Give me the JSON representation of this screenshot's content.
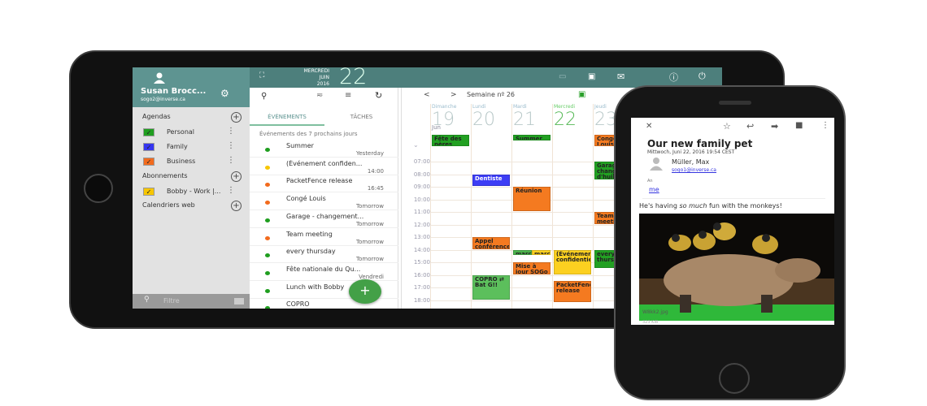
{
  "tablet": {
    "user": {
      "name": "Susan Brocc...",
      "email": "sogo2@inverse.ca"
    },
    "date": {
      "weekday": "MERCREDI",
      "month": "JUIN",
      "year": "2016",
      "day": "22"
    },
    "sidebar": {
      "agendas_label": "Agendas",
      "agendas": [
        {
          "label": "Personal",
          "color": "#1f9e1f"
        },
        {
          "label": "Family",
          "color": "#3535f0"
        },
        {
          "label": "Business",
          "color": "#f26b1d"
        }
      ],
      "subscriptions_label": "Abonnements",
      "subscriptions": [
        {
          "label": "Bobby - Work |...",
          "color": "#f7c600"
        }
      ],
      "web_label": "Calendriers web",
      "filter_placeholder": "Filtre"
    },
    "list": {
      "tabs": [
        {
          "label": "ÉVÉNEMENTS",
          "active": true
        },
        {
          "label": "TÂCHES",
          "active": false
        }
      ],
      "subtitle": "Événements des 7 prochains jours",
      "items": [
        {
          "title": "Summer",
          "when": "Yesterday",
          "color": "#1f9e1f"
        },
        {
          "title": "(Événement confiden...",
          "when": "14:00",
          "color": "#f7c600"
        },
        {
          "title": "PacketFence release",
          "when": "16:45",
          "color": "#f26b1d"
        },
        {
          "title": "Congé Louis",
          "when": "Tomorrow",
          "color": "#f26b1d"
        },
        {
          "title": "Garage - changement...",
          "when": "Tomorrow",
          "color": "#1f9e1f"
        },
        {
          "title": "Team meeting",
          "when": "Tomorrow",
          "color": "#f26b1d"
        },
        {
          "title": "every thursday",
          "when": "Tomorrow",
          "color": "#1f9e1f"
        },
        {
          "title": "Fête nationale du Qu...",
          "when": "Vendredi",
          "color": "#1f9e1f"
        },
        {
          "title": "Lunch with Bobby",
          "when": "",
          "color": "#1f9e1f"
        },
        {
          "title": "COPRO",
          "when": "",
          "color": "#1f9e1f"
        }
      ],
      "fab": "+"
    },
    "calendar": {
      "prev": "<",
      "next": ">",
      "week_label": "Semaine nº 26",
      "month_label": "Jun",
      "days": [
        {
          "name": "Dimanche",
          "num": "19"
        },
        {
          "name": "Lundi",
          "num": "20"
        },
        {
          "name": "Mardi",
          "num": "21"
        },
        {
          "name": "Mercredi",
          "num": "22",
          "today": true
        },
        {
          "name": "Jeudi",
          "num": "23"
        }
      ],
      "hours": [
        "07:00",
        "08:00",
        "09:00",
        "10:00",
        "11:00",
        "12:00",
        "13:00",
        "14:00",
        "15:00",
        "16:00",
        "17:00",
        "18:00"
      ],
      "all_day": [
        {
          "day": 0,
          "title": "Fête des pères",
          "color": "#22a022"
        },
        {
          "day": 2,
          "title": "Summer",
          "color": "#22a022"
        },
        {
          "day": 4,
          "title": "Congé Louis",
          "color": "#f47a20"
        }
      ],
      "events": [
        {
          "day": 1,
          "start": 8,
          "end": 9,
          "title": "Dentiste",
          "color": "#3d3df5"
        },
        {
          "day": 2,
          "start": 9,
          "end": 11,
          "title": "Réunion",
          "color": "#f47a20"
        },
        {
          "day": 1,
          "start": 13,
          "end": 14,
          "title": "Appel conférence",
          "color": "#f47a20"
        },
        {
          "day": 2,
          "start": 14,
          "end": 14.5,
          "title": "marc",
          "color": "#4cb34c",
          "half": 0
        },
        {
          "day": 2,
          "start": 14,
          "end": 14.5,
          "title": "marc",
          "color": "#fcd020",
          "half": 1
        },
        {
          "day": 3,
          "start": 14,
          "end": 16,
          "title": "(Événement confidentiel)",
          "color": "#fcd020"
        },
        {
          "day": 2,
          "start": 15,
          "end": 16,
          "title": "Mise à jour SOGo",
          "color": "#f47a20"
        },
        {
          "day": 1,
          "start": 16,
          "end": 18,
          "title": "COPRO ⇄ Bat G!!",
          "color": "#5cbf5c"
        },
        {
          "day": 3,
          "start": 16.5,
          "end": 18.2,
          "title": "PacketFence release",
          "color": "#f47a20"
        },
        {
          "day": 4,
          "start": 7,
          "end": 8.5,
          "title": "Garage changement d'huile",
          "color": "#22a022"
        },
        {
          "day": 4,
          "start": 11,
          "end": 12,
          "title": "Team meeting",
          "color": "#f47a20"
        },
        {
          "day": 4,
          "start": 14,
          "end": 15.5,
          "title": "every thursday",
          "color": "#22a022"
        }
      ]
    }
  },
  "phone": {
    "subject": "Our new family pet",
    "date": "Mittwoch, Juni 22, 2016 19:54 CEST",
    "from_name": "Müller, Max",
    "from_email": "sogo1@inverse.ca",
    "to_label": "An",
    "to": "me",
    "body_pre": "He's having ",
    "body_em": "so much",
    "body_post": " fun with the monkeys!",
    "attachment": "W8kk2.jpg",
    "attachment_size": "323 KiB"
  }
}
